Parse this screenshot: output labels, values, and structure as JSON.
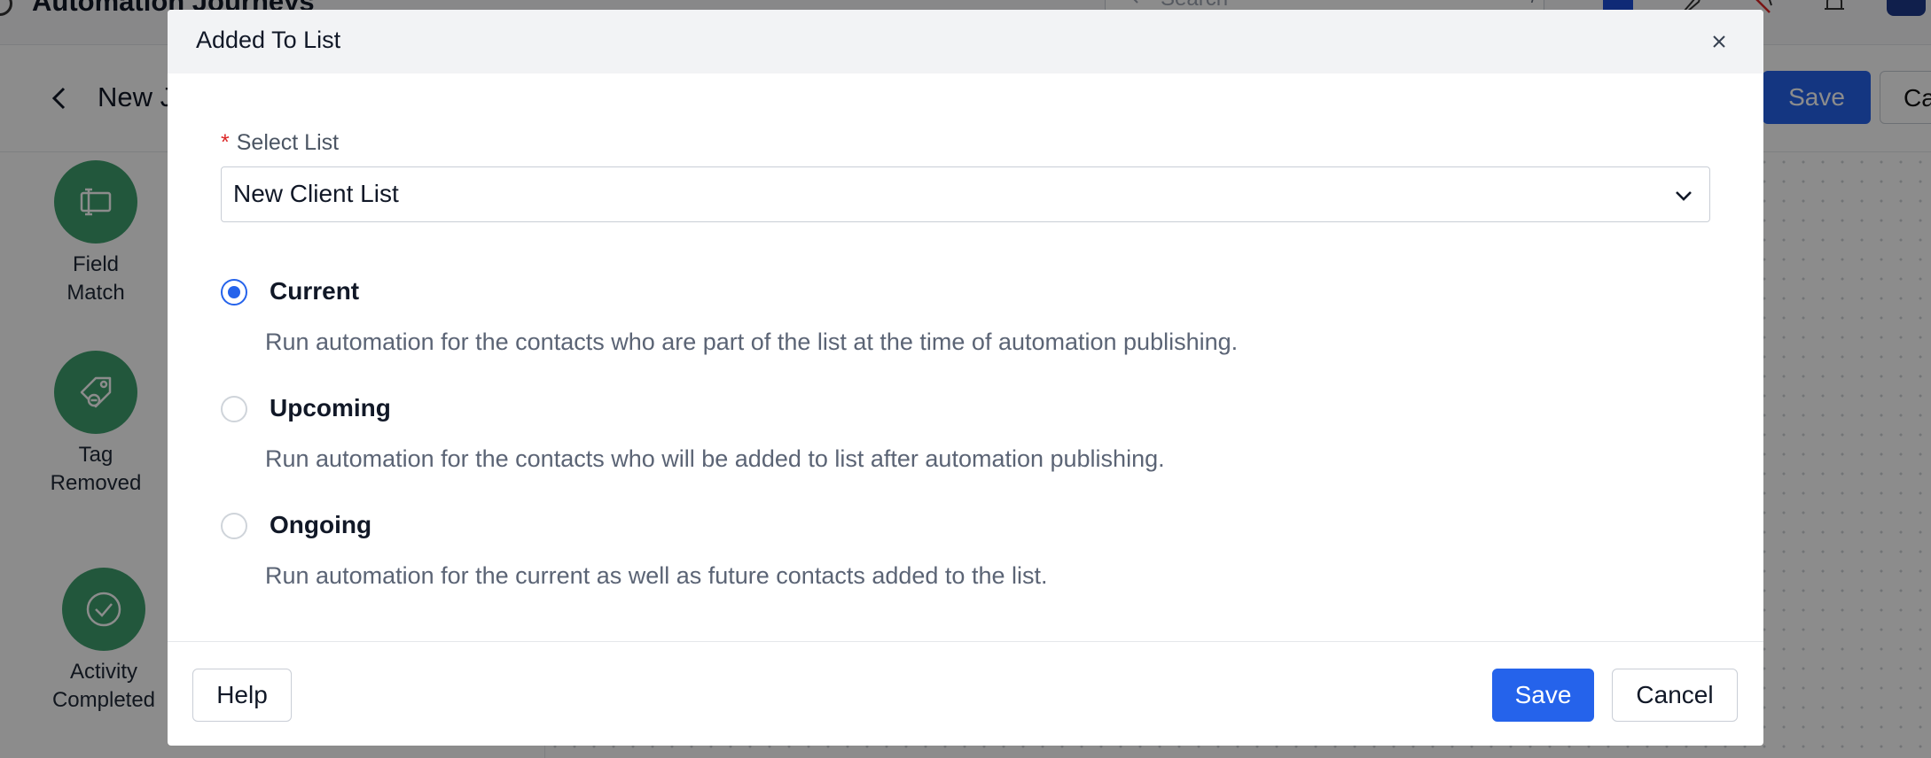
{
  "app": {
    "title": "Automation Journeys",
    "search_placeholder": "Search",
    "search_shortcut": "/",
    "journey_name": "New J",
    "save_label": "Save",
    "cancel_label": "Ca"
  },
  "sidebar": {
    "tiles": [
      {
        "label_line1": "Field",
        "label_line2": "Match",
        "icon": "field-match-icon"
      },
      {
        "label_line1": "Tag",
        "label_line2": "Removed",
        "icon": "tag-removed-icon"
      },
      {
        "label_line1": "Activity",
        "label_line2": "Completed",
        "icon": "check-circle-icon"
      }
    ]
  },
  "modal": {
    "title": "Added To List",
    "field": {
      "required_mark": "*",
      "label": "Select List",
      "value": "New Client List"
    },
    "options": [
      {
        "title": "Current",
        "description": "Run automation for the contacts who are part of the list at the time of automation publishing.",
        "checked": true
      },
      {
        "title": "Upcoming",
        "description": "Run automation for the contacts who will be added to list after automation publishing.",
        "checked": false
      },
      {
        "title": "Ongoing",
        "description": "Run automation for the current as well as future contacts added to the list.",
        "checked": false
      }
    ],
    "buttons": {
      "help": "Help",
      "save": "Save",
      "cancel": "Cancel"
    }
  },
  "colors": {
    "accent": "#2563eb",
    "tile_green": "#3f9e6e",
    "required": "#dc2626"
  }
}
